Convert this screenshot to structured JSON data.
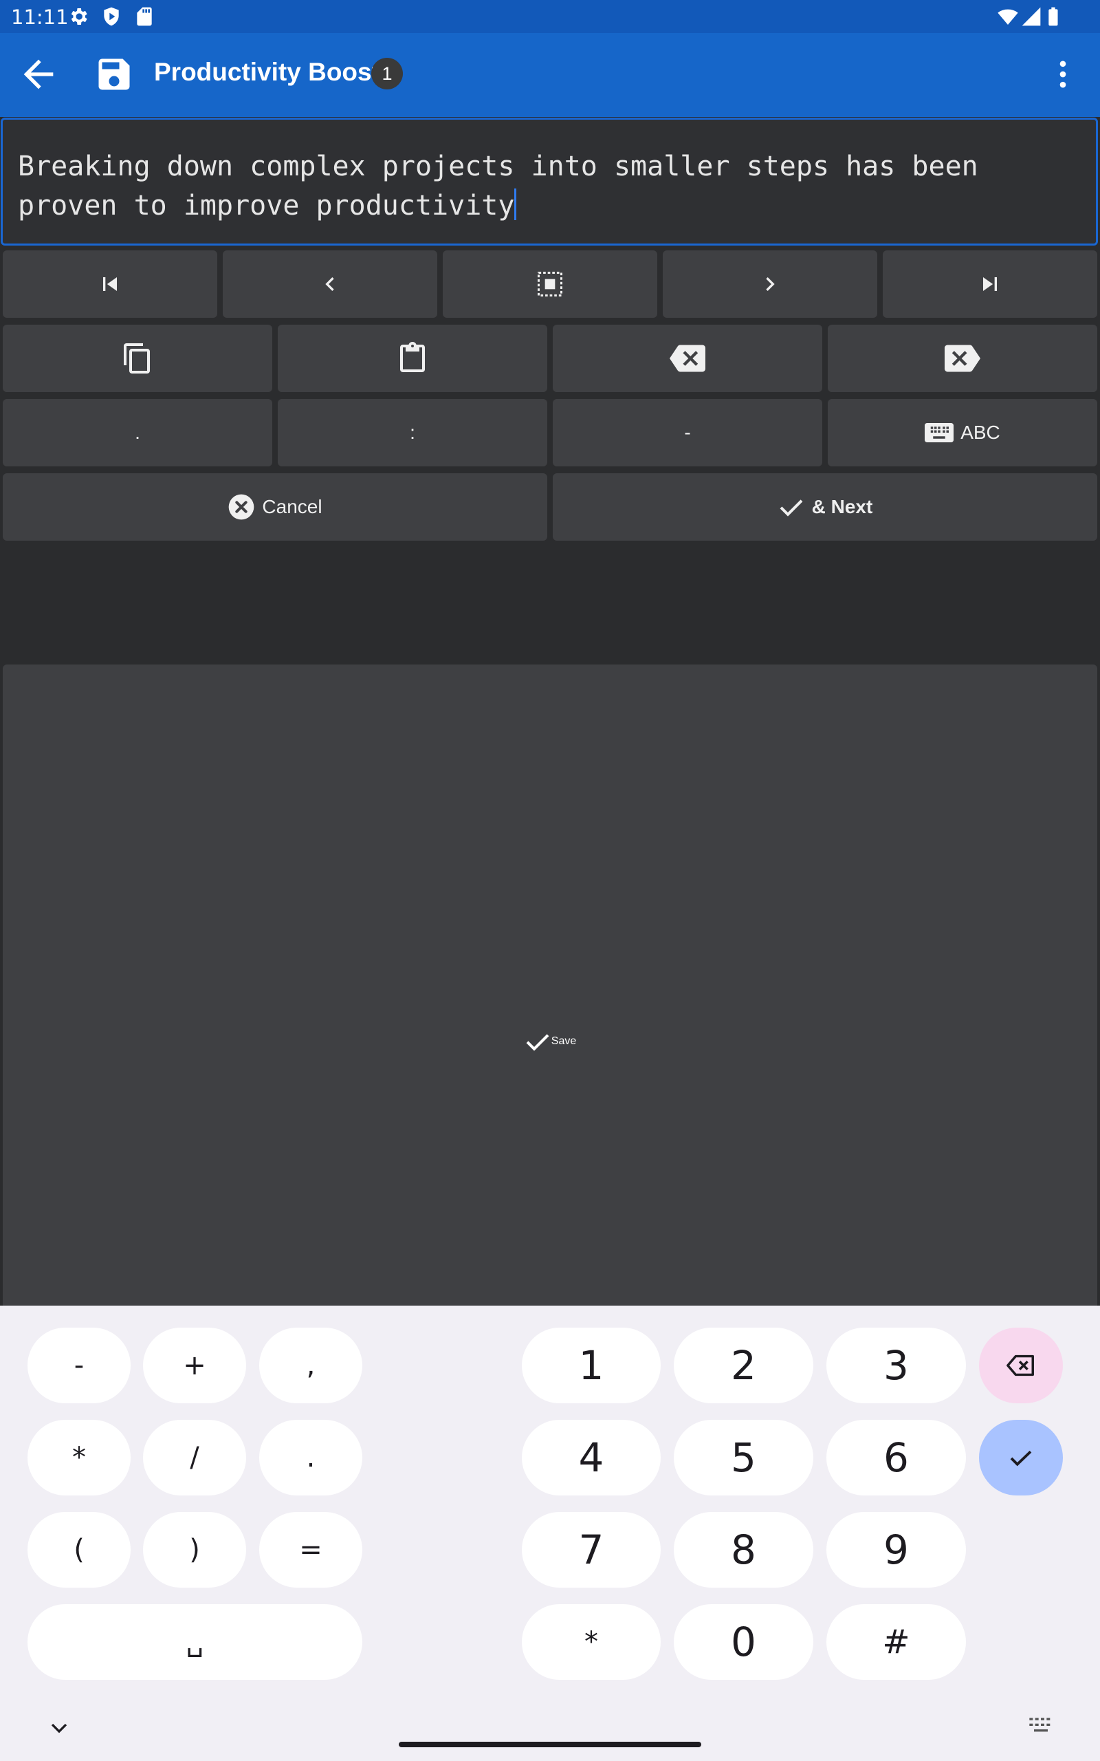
{
  "status_bar": {
    "time": "11:11",
    "icons": [
      "gear-icon",
      "shield-icon",
      "sd-card-icon",
      "wifi-icon",
      "signal-icon",
      "battery-icon"
    ]
  },
  "app_bar": {
    "title": "Productivity Boost",
    "badge": "1",
    "icons": [
      "back-arrow-icon",
      "save-disk-icon",
      "more-vert-icon"
    ],
    "color": "#1666c9"
  },
  "editor": {
    "text": "Breaking down complex projects into smaller steps has been proven to improve productivity",
    "accent": "#1a67d3"
  },
  "toolbar": {
    "row1_icons": [
      "skip-to-start-icon",
      "chevron-left-icon",
      "select-all-icon",
      "chevron-right-icon",
      "skip-to-end-icon"
    ],
    "row2_icons": [
      "copy-icon",
      "paste-clipboard-icon",
      "backspace-icon",
      "delete-forward-icon"
    ],
    "row3": {
      "period": ".",
      "colon": ":",
      "dash": "-",
      "abc_label": "ABC"
    },
    "cancel_label": "Cancel",
    "next_label": "& Next",
    "save_label": "Save"
  },
  "keyboard": {
    "symbols": [
      "-",
      "+",
      ",",
      "*",
      "/",
      ".",
      "(",
      ")",
      "="
    ],
    "space_glyph": "␣",
    "digits": [
      "1",
      "2",
      "3",
      "4",
      "5",
      "6",
      "7",
      "8",
      "9",
      "*",
      "0",
      "#"
    ],
    "icons": [
      "backspace-icon",
      "check-icon",
      "collapse-chevron-icon",
      "keyboard-switch-icon"
    ],
    "delete_color": "#f8d8ee",
    "enter_color": "#a9c3ff"
  }
}
